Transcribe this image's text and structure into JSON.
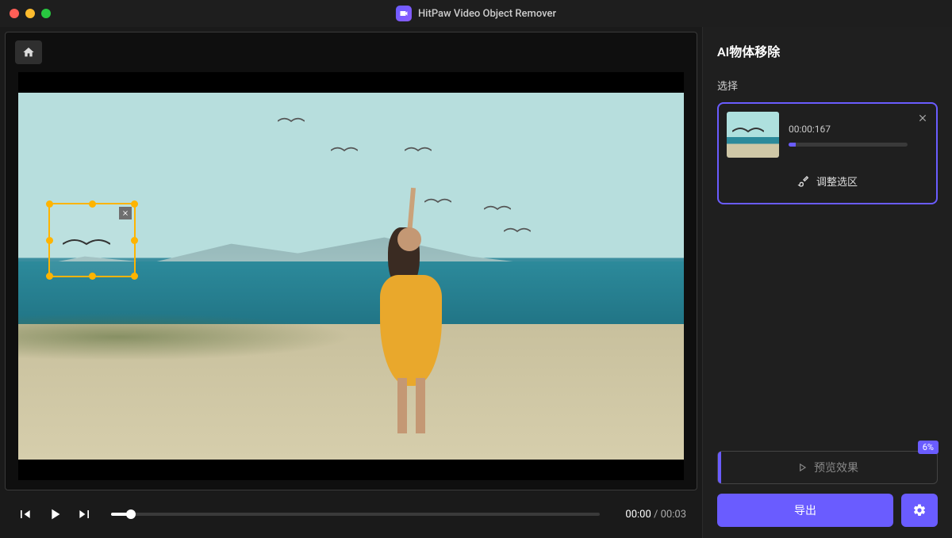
{
  "app": {
    "title": "HitPaw Video Object Remover"
  },
  "playback": {
    "current": "00:00",
    "total": "00:03",
    "progress_pct": 4
  },
  "sidebar": {
    "title": "AI物体移除",
    "select_label": "选择",
    "selection": {
      "timestamp": "00:00:167",
      "progress_pct": 6
    },
    "adjust_label": "调整选区",
    "preview_label": "预览效果",
    "preview_progress_pct": "6%",
    "export_label": "导出"
  },
  "colors": {
    "accent": "#6a5cff",
    "handle": "#ffb400"
  }
}
